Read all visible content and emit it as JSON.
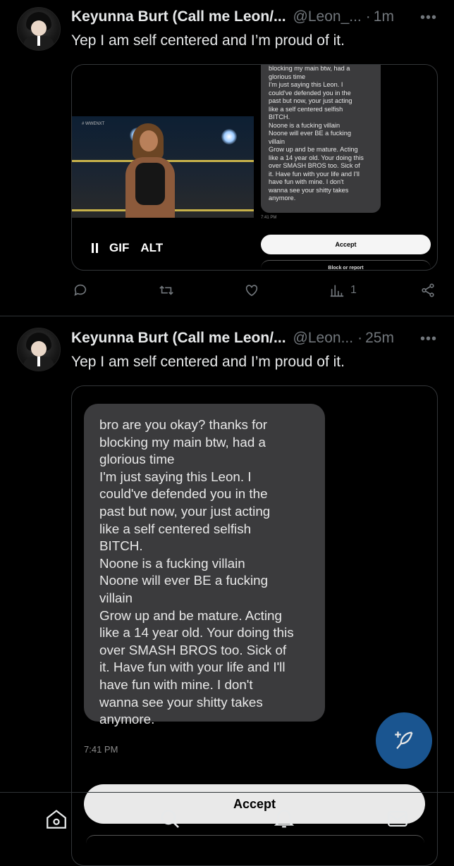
{
  "tweets": [
    {
      "display_name": "Keyunna Burt (Call me Leon/...",
      "handle": "@Leon_...",
      "separator": "·",
      "time": "1m",
      "text": "Yep I am self centered and I’m proud of it.",
      "media": {
        "gif_label": "GIF",
        "alt_label": "ALT",
        "watermark": "# WWENXT",
        "bubble_lines": [
          "blocking my main btw, had a",
          "glorious time",
          "I'm just saying this Leon. I",
          "could've defended you in the",
          "past but now, your just acting",
          "like a self centered selfish",
          "BITCH.",
          "Noone is a fucking villain",
          "Noone will ever BE a fucking",
          "villain",
          "Grow up and be mature. Acting",
          "like a 14 year old. Your doing this",
          "over SMASH BROS too. Sick of",
          "it. Have fun with your life and I'll",
          "have fun with mine. I don't",
          "wanna see your shitty takes",
          "anymore."
        ],
        "message_time": "7:41 PM",
        "accept_label": "Accept",
        "block_label": "Block or report"
      },
      "view_count": "1"
    },
    {
      "display_name": "Keyunna Burt (Call me Leon/...",
      "handle": "@Leon...",
      "separator": "·",
      "time": "25m",
      "text": "Yep I am self centered and I’m proud of it.",
      "media": {
        "bubble_lines": [
          "bro are you okay? thanks for",
          "blocking my main btw, had a",
          "glorious time",
          "I'm just saying this Leon. I",
          "could've defended you in the",
          "past but now, your just acting",
          "like a self centered selfish",
          "BITCH.",
          "Noone is a fucking villain",
          "Noone will ever BE a fucking",
          "villain",
          "Grow up and be mature. Acting",
          "like a 14 year old. Your doing this",
          "over SMASH BROS too. Sick of",
          "it. Have fun with your life and I'll",
          "have fun with mine. I don't",
          "wanna see your shitty takes",
          "anymore."
        ],
        "message_time": "7:41 PM",
        "accept_label": "Accept"
      }
    }
  ],
  "more_glyph": "•••",
  "colors": {
    "background": "#000000",
    "text": "#e7e9ea",
    "muted": "#71767b",
    "fab": "#1d5fa0",
    "bubble": "#3b3b3d"
  },
  "icons": {
    "actions": [
      "reply-icon",
      "retweet-icon",
      "like-icon",
      "views-icon",
      "share-icon"
    ],
    "nav": [
      "home-icon",
      "search-icon",
      "notifications-icon",
      "messages-icon"
    ],
    "fab": "compose-icon"
  }
}
